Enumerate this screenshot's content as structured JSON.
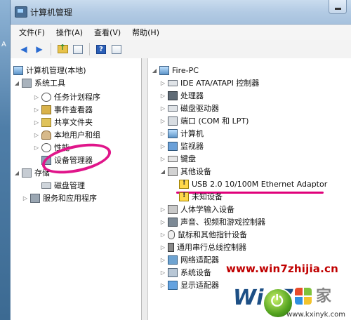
{
  "window": {
    "title": "计算机管理"
  },
  "menu": [
    "文件(F)",
    "操作(A)",
    "查看(V)",
    "帮助(H)"
  ],
  "toolbar": {
    "icons": [
      "back-arrow-icon",
      "forward-arrow-icon",
      "up-folder-icon",
      "show-hide-tree-icon",
      "help-icon",
      "properties-icon"
    ]
  },
  "left_tree": {
    "root": "计算机管理(本地)",
    "system_tools": "系统工具",
    "task_scheduler": "任务计划程序",
    "event_viewer": "事件查看器",
    "shared_folders": "共享文件夹",
    "local_users": "本地用户和组",
    "performance": "性能",
    "device_manager": "设备管理器",
    "storage": "存储",
    "disk_management": "磁盘管理",
    "services_apps": "服务和应用程序"
  },
  "right_tree": {
    "root": "Fire-PC",
    "items": [
      "IDE ATA/ATAPI 控制器",
      "处理器",
      "磁盘驱动器",
      "端口 (COM 和 LPT)",
      "计算机",
      "监视器",
      "键盘",
      "其他设备",
      "USB 2.0 10/100M Ethernet Adaptor",
      "未知设备",
      "人体学输入设备",
      "声音、视频和游戏控制器",
      "鼠标和其他指针设备",
      "通用串行总线控制器",
      "网络适配器",
      "系统设备",
      "显示适配器"
    ]
  },
  "watermark": {
    "site": "www.win7zhijia.cn",
    "logo_text": "Win7",
    "brand": "家",
    "small_url": "www.kxinyk.com"
  },
  "colors": {
    "highlight": "#e0158a",
    "watermark_red": "#c00000"
  }
}
